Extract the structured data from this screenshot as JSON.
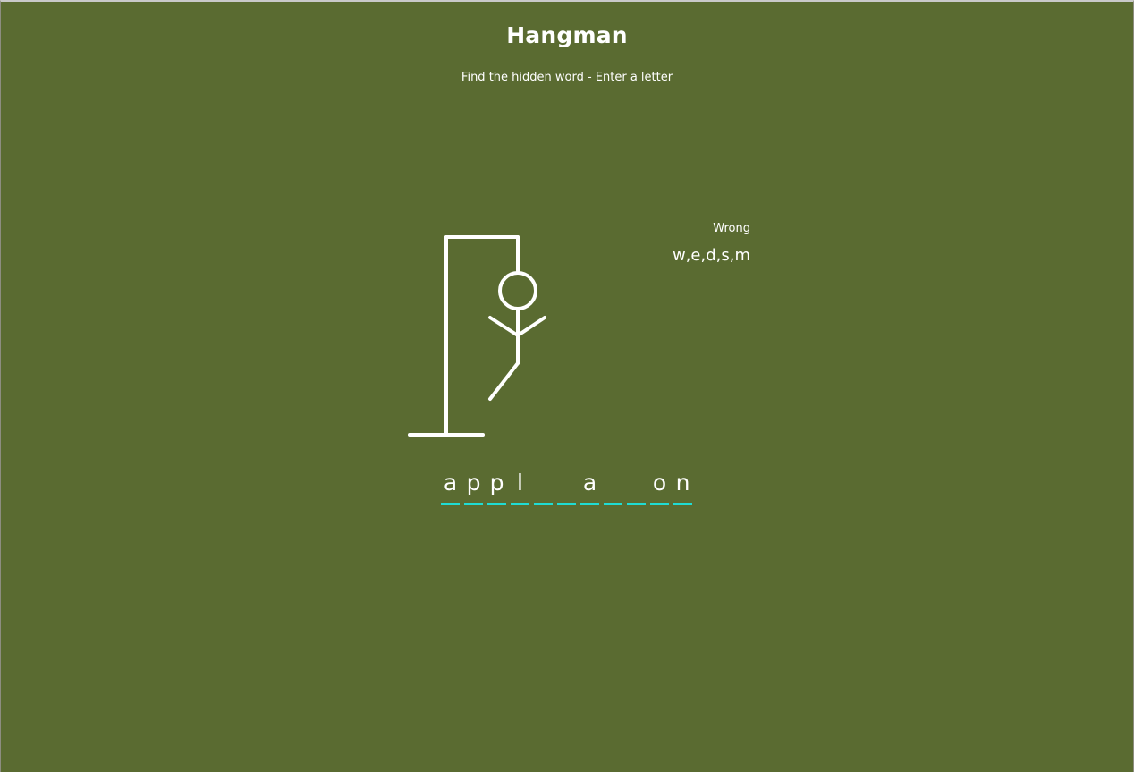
{
  "title": "Hangman",
  "subtitle": "Find the hidden word - Enter a letter",
  "wrong": {
    "label": "Wrong",
    "letters": "w,e,d,s,m"
  },
  "word": [
    "a",
    "p",
    "p",
    "l",
    "",
    "",
    "a",
    "",
    "",
    "o",
    "n"
  ],
  "colors": {
    "background": "#5a6b31",
    "text": "#ffffff",
    "dash": "#1fdcd4"
  },
  "figure_parts_shown": [
    "base",
    "pole",
    "beam",
    "rope",
    "head",
    "body",
    "left-arm",
    "right-arm",
    "left-leg"
  ]
}
